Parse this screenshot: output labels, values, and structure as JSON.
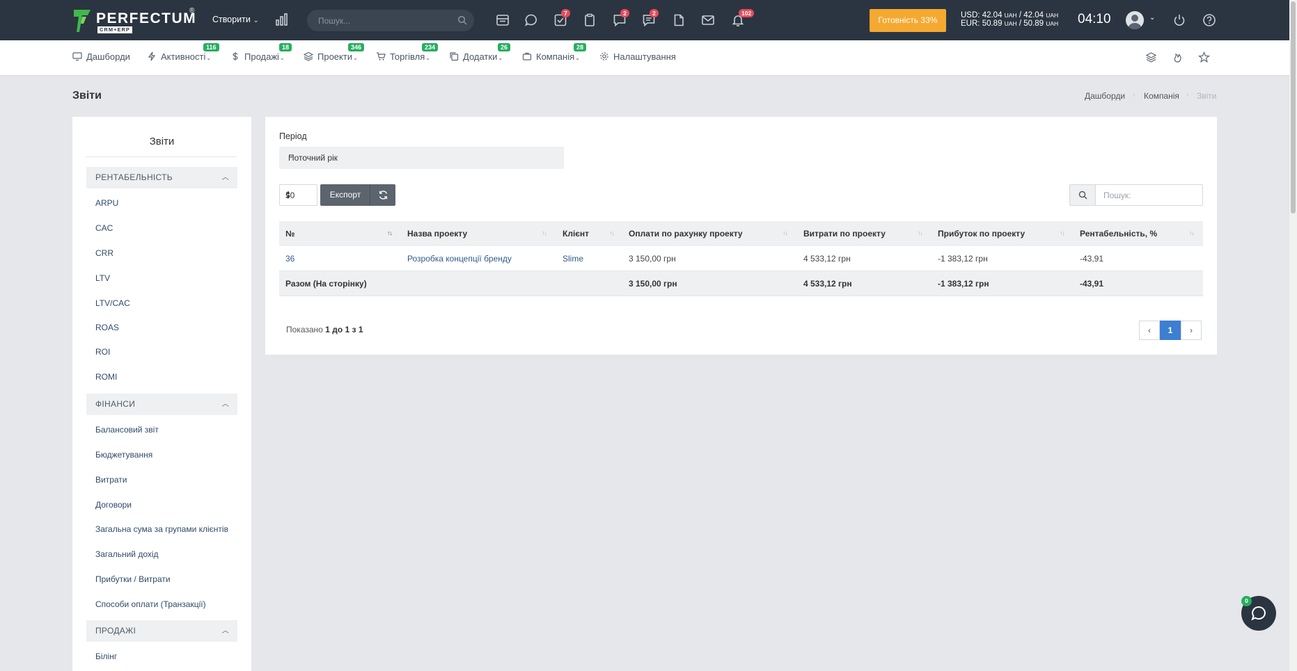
{
  "app": {
    "brand": "PERFECTUM",
    "brand_sub": "CRM+ERP",
    "reg": "®",
    "create_label": "Створити",
    "search_placeholder": "Пошук...",
    "badges": {
      "tasks": "7",
      "chat": "2",
      "messages": "2",
      "notifications": "102"
    },
    "readiness_label": "Готовність 33%",
    "rates": {
      "usd_label": "USD:",
      "usd_buy": "42.04",
      "usd_sell": "42.04",
      "eur_label": "EUR:",
      "eur_buy": "50.89",
      "eur_sell": "50.89",
      "currency": "UAH",
      "sep": "/"
    },
    "clock": "04:10"
  },
  "nav": {
    "items": [
      {
        "label": "Дашборди",
        "icon": "monitor-icon"
      },
      {
        "label": "Активності",
        "icon": "bolt-icon",
        "badge": "116"
      },
      {
        "label": "Продажі",
        "icon": "dollar-icon",
        "badge": "18"
      },
      {
        "label": "Проекти",
        "icon": "layers-icon",
        "badge": "346"
      },
      {
        "label": "Торгівля",
        "icon": "cart-icon",
        "badge": "234"
      },
      {
        "label": "Додатки",
        "icon": "copy-icon",
        "badge": "26"
      },
      {
        "label": "Компанія",
        "icon": "briefcase-icon",
        "badge": "28"
      },
      {
        "label": "Налаштування",
        "icon": "gear-icon"
      }
    ]
  },
  "page": {
    "title": "Звіти",
    "breadcrumb": [
      "Дашборди",
      "Компанія",
      "Звіти"
    ]
  },
  "sidebar": {
    "title": "Звіти",
    "sections": [
      {
        "label": "РЕНТАБЕЛЬНІСТЬ",
        "items": [
          "ARPU",
          "CAC",
          "CRR",
          "LTV",
          "LTV/CAC",
          "ROAS",
          "ROI",
          "ROMI"
        ]
      },
      {
        "label": "ФІНАНСИ",
        "items": [
          "Балансовий звіт",
          "Бюджетування",
          "Витрати",
          "Договори",
          "Загальна сума за групами клієнтів",
          "Загальний дохід",
          "Прибутки / Витрати",
          "Способи оплати (Транзакції)"
        ]
      },
      {
        "label": "ПРОДАЖІ",
        "items": [
          "Білінг"
        ]
      }
    ]
  },
  "report": {
    "period_label": "Період",
    "period_value": "Поточний рік",
    "page_length": "50",
    "export_label": "Експорт",
    "search_placeholder": "Пошук:",
    "columns": [
      "№",
      "Назва проекту",
      "Клієнт",
      "Оплати по рахунку проекту",
      "Витрати по проекту",
      "Прибуток по проекту",
      "Рентабельність, %"
    ],
    "rows": [
      [
        "36",
        "Розробка концепції бренду",
        "Slime",
        "3 150,00 грн",
        "4 533,12 грн",
        "-1 383,12 грн",
        "-43,91"
      ]
    ],
    "totals": [
      "Разом (На сторінку)",
      "",
      "",
      "3 150,00 грн",
      "4 533,12 грн",
      "-1 383,12 грн",
      "-43,91"
    ],
    "info": {
      "prefix": "Показано",
      "from": "1",
      "to_word": "до",
      "to": "1",
      "of_word": "з",
      "total": "1"
    },
    "current_page": "1"
  },
  "chat_fab": {
    "badge": "0"
  },
  "colors": {
    "topbar": "#2b3541",
    "accent": "#3d7fd1",
    "badge_green": "#27ae60",
    "badge_red": "#e74c5b",
    "readiness": "#f5a930"
  }
}
